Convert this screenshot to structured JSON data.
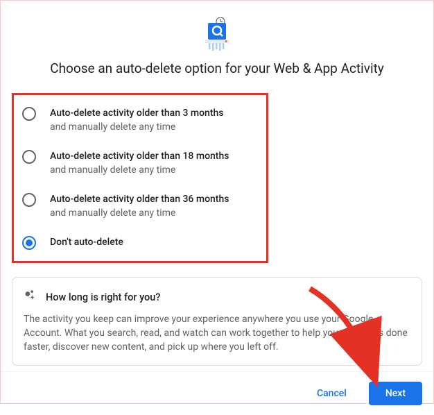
{
  "title": "Choose an auto-delete option for your Web & App Activity",
  "options": [
    {
      "label": "Auto-delete activity older than 3 months",
      "sub": "and manually delete any time",
      "selected": false
    },
    {
      "label": "Auto-delete activity older than 18 months",
      "sub": "and manually delete any time",
      "selected": false
    },
    {
      "label": "Auto-delete activity older than 36 months",
      "sub": "and manually delete any time",
      "selected": false
    },
    {
      "label": "Don't auto-delete",
      "sub": "",
      "selected": true
    }
  ],
  "info": {
    "title": "How long is right for you?",
    "text": "The activity you keep can improve your experience anywhere you use your Google Account. What you search, read, and watch can work together to help you get things done faster, discover new content, and pick up where you left off."
  },
  "buttons": {
    "cancel": "Cancel",
    "next": "Next"
  }
}
